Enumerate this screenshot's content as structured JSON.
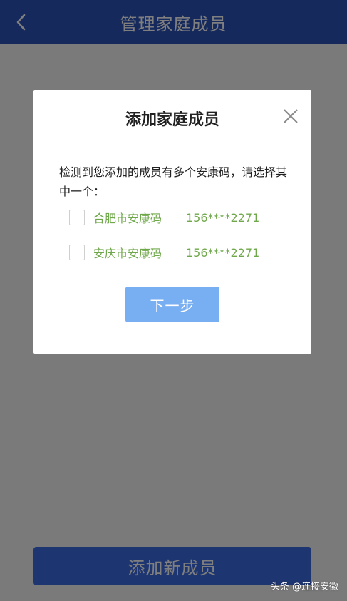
{
  "header": {
    "title": "管理家庭成员",
    "back_icon": "chevron-left-icon"
  },
  "page": {
    "add_member_label": "添加新成员"
  },
  "dialog": {
    "title": "添加家庭成员",
    "close_icon": "close-icon",
    "message": "检测到您添加的成员有多个安康码，请选择其中一个：",
    "options": [
      {
        "name": "合肥市安康码",
        "phone": "156****2271",
        "checked": false
      },
      {
        "name": "安庆市安康码",
        "phone": "156****2271",
        "checked": false
      }
    ],
    "next_label": "下一步"
  },
  "watermark": "头条 @连接安徽",
  "colors": {
    "header_bg": "#2b53b8",
    "primary_button": "#3b6be0",
    "next_button": "#78aef2",
    "option_text": "#6fa84a"
  }
}
